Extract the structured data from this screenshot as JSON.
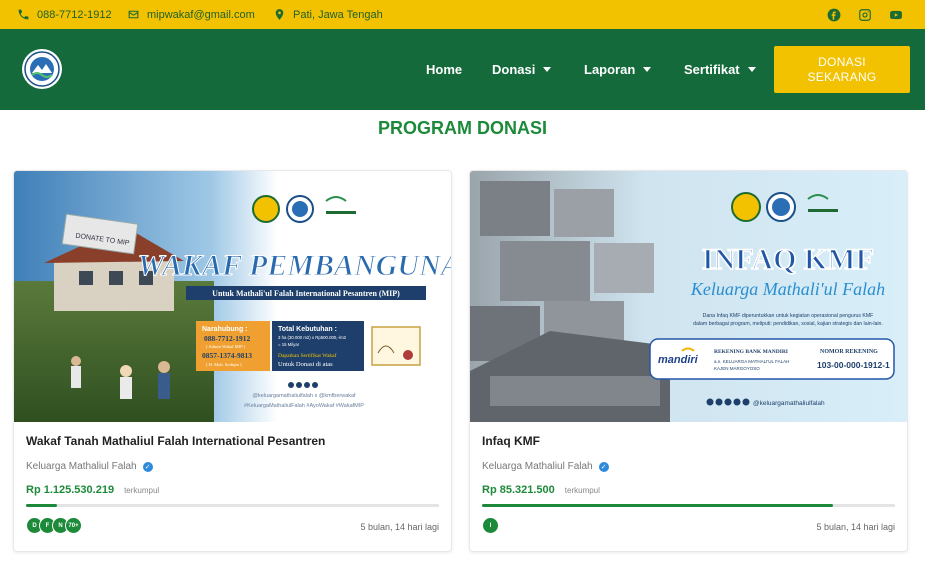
{
  "topbar": {
    "phone": "088-7712-1912",
    "email": "mipwakaf@gmail.com",
    "location": "Pati, Jawa Tengah",
    "social": [
      "facebook-icon",
      "instagram-icon",
      "youtube-icon"
    ]
  },
  "nav": {
    "links": [
      {
        "label": "Home",
        "dropdown": false
      },
      {
        "label": "Donasi",
        "dropdown": true
      },
      {
        "label": "Laporan",
        "dropdown": true
      },
      {
        "label": "Sertifikat",
        "dropdown": true
      }
    ],
    "cta_line1": "DONASI",
    "cta_line2": "SEKARANG"
  },
  "section_title": "PROGRAM DONASI",
  "colors": {
    "brand_green": "#146a3b",
    "accent_yellow": "#f2c200",
    "text_green": "#1d8a3a"
  },
  "cards": [
    {
      "banner": {
        "headline": "WAKAF PEMBANGUNAN",
        "subheadline": "Untuk Mathali'ul Falah International Pesantren (MIP)",
        "sign": "DONATE TO MIP",
        "contact_title": "Narahubung :",
        "contact_1": "088-7712-1912",
        "contact_1_name": "( Admin Wakaf MIP )",
        "contact_2": "0857-1374-9813",
        "contact_2_name": "( H. Moh. Sodiqin )",
        "need_title": "Total Kebutuhan :",
        "need_line1": "3 ha (30.000 m2) x Rp500.000,-/m2",
        "need_line2": "= 15 Milyar",
        "cert_line1": "Dapatkan Sertifikat Wakaf",
        "cert_line2": "Untuk Donasi di atas",
        "handles": "@keluargamathaliulfalah x @kmfberwakaf",
        "hashtags": "#KeluargaMathaliulFalah #AyoWakaf #WakafMIP"
      },
      "title": "Wakaf Tanah Mathaliul Falah International Pesantren",
      "organizer": "Keluarga Mathaliul Falah",
      "amount": "Rp 1.125.530.219",
      "amount_suffix": "terkumpul",
      "progress": 0.075,
      "donors": [
        "D",
        "F",
        "N",
        "70+"
      ],
      "remaining": "5 bulan, 14 hari lagi"
    },
    {
      "banner": {
        "headline": "INFAQ KMF",
        "script": "Keluarga Mathali'ul Falah",
        "desc_line1": "Dana Infaq KMF diperuntukkan untuk kegiatan operasional pengurus KMF",
        "desc_line2": "dalam berbagai program, meliputi: pendidikan, sosial, kajian strategis dan lain-lain.",
        "bank_title": "REKENING BANK MANDIRI",
        "bank_name": "mandiri",
        "account_holder_1": "a.n. KELUARGA MATHALI'UL FALAH",
        "account_holder_2": "KAJEN MARGOYOSO",
        "account_label": "NOMOR REKENING",
        "account_number": "103-00-000-1912-1",
        "handle": "@keluargamathaliulfalah"
      },
      "title": "Infaq KMF",
      "organizer": "Keluarga Mathaliul Falah",
      "amount": "Rp 85.321.500",
      "amount_suffix": "terkumpul",
      "progress": 0.85,
      "donors": [
        "I"
      ],
      "remaining": "5 bulan, 14 hari lagi"
    }
  ]
}
